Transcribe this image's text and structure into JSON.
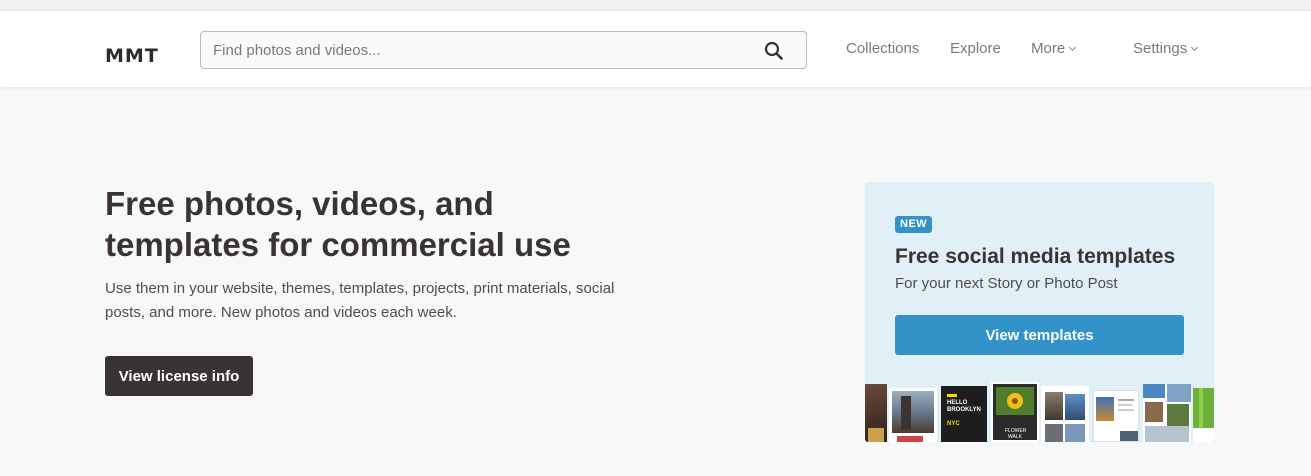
{
  "header": {
    "logo": "MMT",
    "search": {
      "placeholder": "Find photos and videos...",
      "value": ""
    },
    "nav": {
      "collections": "Collections",
      "explore": "Explore",
      "more": "More",
      "settings": "Settings"
    }
  },
  "hero": {
    "title": "Free photos, videos, and templates for commercial use",
    "subtitle": "Use them in your website, themes, templates, projects, print materials, social posts, and more. New photos and videos each week.",
    "license_button": "View license info"
  },
  "promo": {
    "badge": "NEW",
    "title": "Free social media templates",
    "subtitle": "For your next Story or Photo Post",
    "button": "View templates",
    "thumb_texts": {
      "hello": "HELLO",
      "brooklyn": "BROOKLYN",
      "nyc": "NYC",
      "flower": "FLOWER",
      "walk": "WALK"
    }
  },
  "colors": {
    "accent": "#3393c9",
    "dark": "#3a3334",
    "promo_bg": "#e1eff7",
    "page_bg": "#f7f8fa"
  }
}
